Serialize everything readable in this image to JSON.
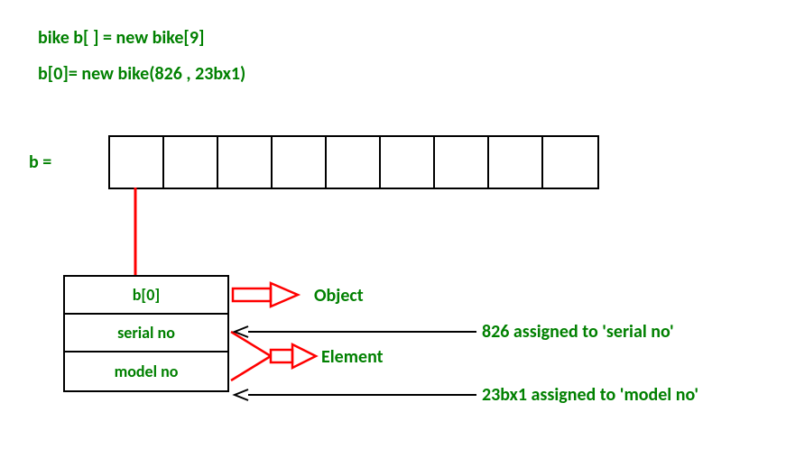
{
  "code": {
    "line1": "bike b[ ] = new bike[9]",
    "line2": "b[0]= new bike(826 , 23bx1)"
  },
  "array_label": "b  =",
  "array_cells": 9,
  "struct": {
    "header": "b[0]",
    "field1": "serial no",
    "field2": "model no"
  },
  "labels": {
    "object": "Object",
    "element": "Element",
    "assign1": "826 assigned to 'serial no'",
    "assign2": "23bx1 assigned to 'model no'"
  },
  "chart_data": {
    "type": "diagram",
    "description": "Java-style array of objects illustration",
    "array_declaration": "bike b[] = new bike[9]",
    "array_size": 9,
    "element_assignment": "b[0] = new bike(826, 23bx1)",
    "object_index": 0,
    "object_fields": [
      {
        "name": "serial no",
        "value": "826"
      },
      {
        "name": "model no",
        "value": "23bx1"
      }
    ],
    "annotations": [
      {
        "target": "b[0]",
        "label": "Object"
      },
      {
        "target": [
          "serial no",
          "model no"
        ],
        "label": "Element"
      }
    ]
  }
}
